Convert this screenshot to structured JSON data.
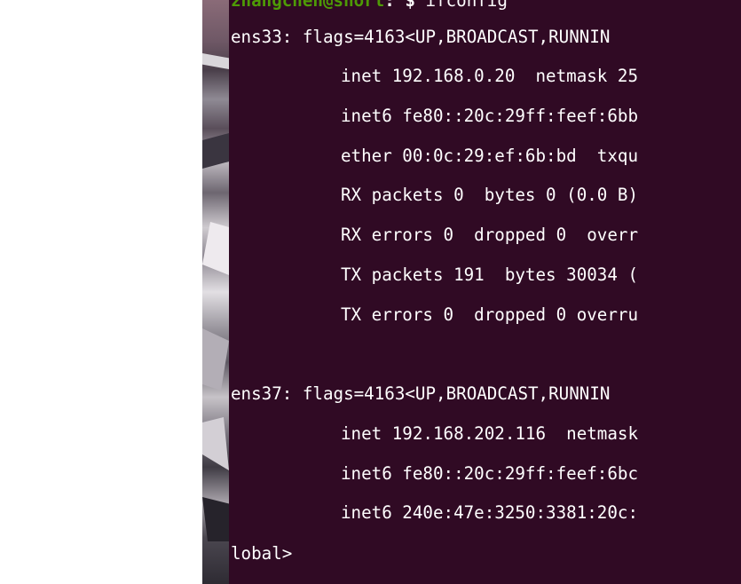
{
  "terminal": {
    "prompt": {
      "user_host": "zhangchen@short",
      "symbol": ": $ ",
      "command": "ifconfig"
    },
    "lines": [
      "ens33: flags=4163<UP,BROADCAST,RUNNIN",
      "inet 192.168.0.20  netmask 25",
      "inet6 fe80::20c:29ff:feef:6bb",
      "ether 00:0c:29:ef:6b:bd  txqu",
      "RX packets 0  bytes 0 (0.0 B)",
      "RX errors 0  dropped 0  overr",
      "TX packets 191  bytes 30034 (",
      "TX errors 0  dropped 0 overru",
      "",
      "ens37: flags=4163<UP,BROADCAST,RUNNIN",
      "inet 192.168.202.116  netmask",
      "inet6 fe80::20c:29ff:feef:6bc",
      "inet6 240e:47e:3250:3381:20c:",
      "lobal>"
    ]
  },
  "colors": {
    "terminal_bg": "#300a24",
    "terminal_fg": "#ffffff",
    "prompt_user": "#4e9a06"
  }
}
